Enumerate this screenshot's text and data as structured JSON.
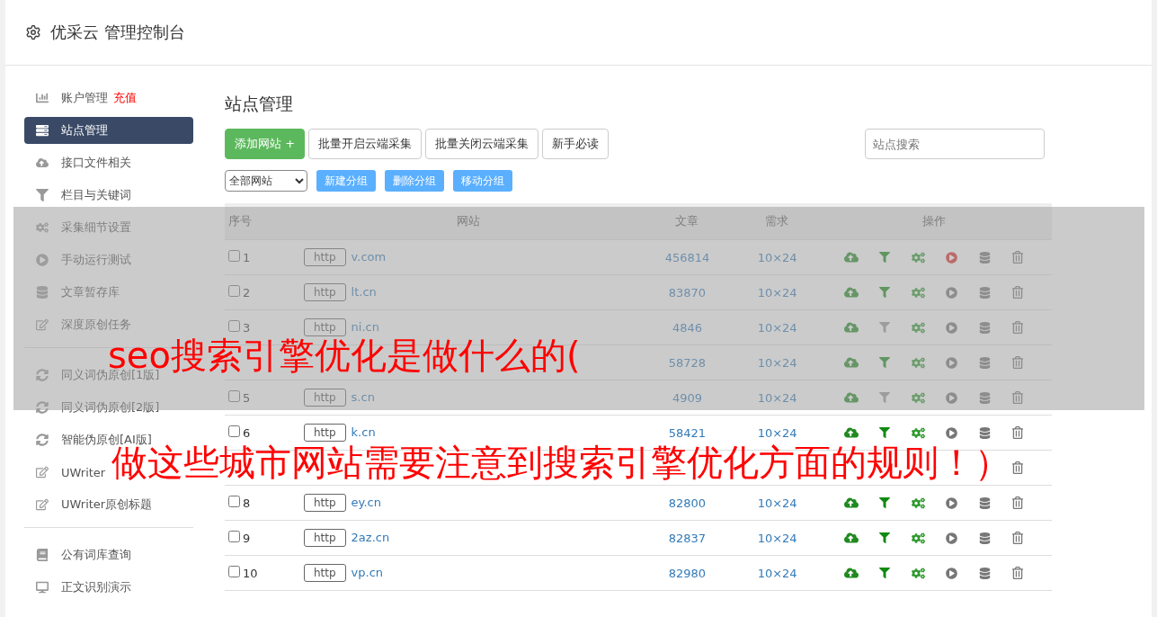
{
  "header": {
    "title": "优采云 管理控制台"
  },
  "sidebar": {
    "groups": [
      {
        "items": [
          {
            "kind": "chart",
            "label": "账户管理",
            "badge": "充值",
            "selected": false
          },
          {
            "kind": "server",
            "label": "站点管理",
            "selected": true
          },
          {
            "kind": "cloud",
            "label": "接口文件相关",
            "selected": false
          },
          {
            "kind": "filter",
            "label": "栏目与关键词",
            "selected": false
          },
          {
            "kind": "cogs",
            "label": "采集细节设置",
            "selected": false
          },
          {
            "kind": "play",
            "label": "手动运行测试",
            "selected": false
          },
          {
            "kind": "database",
            "label": "文章暂存库",
            "selected": false
          },
          {
            "kind": "edit",
            "label": "深度原创任务",
            "selected": false
          }
        ]
      },
      {
        "items": [
          {
            "kind": "sync",
            "label": "同义词伪原创[1版]",
            "selected": false
          },
          {
            "kind": "sync",
            "label": "同义词伪原创[2版]",
            "selected": false
          },
          {
            "kind": "sync",
            "label": "智能伪原创[AI版]",
            "selected": false
          },
          {
            "kind": "edit",
            "label": "UWriter",
            "selected": false
          },
          {
            "kind": "edit",
            "label": "UWriter原创标题",
            "selected": false
          }
        ]
      },
      {
        "items": [
          {
            "kind": "book",
            "label": "公有词库查询",
            "selected": false
          },
          {
            "kind": "desktop",
            "label": "正文识别演示",
            "selected": false
          }
        ]
      }
    ]
  },
  "main": {
    "title": "站点管理",
    "toolbar": [
      {
        "label": "添加网站 +",
        "kind": "primary"
      },
      {
        "label": "批量开启云端采集",
        "kind": "default"
      },
      {
        "label": "批量关闭云端采集",
        "kind": "default"
      },
      {
        "label": "新手必读",
        "kind": "default"
      }
    ],
    "search": {
      "placeholder": "站点搜索"
    },
    "group_select": {
      "value": "全部网站"
    },
    "group_buttons": [
      "新建分组",
      "删除分组",
      "移动分组"
    ],
    "table": {
      "columns": [
        "序号",
        "网站",
        "文章",
        "需求",
        "操作"
      ],
      "rows": [
        {
          "no": "1",
          "checked": false,
          "protocol": "http",
          "site": "v.com",
          "articles": "456814",
          "demand": "10×24",
          "actions": [
            {
              "kind": "upload"
            },
            {
              "kind": "filter",
              "on": true
            },
            {
              "kind": "gears"
            },
            {
              "kind": "play",
              "on": true
            },
            {
              "kind": "database"
            },
            {
              "kind": "trash"
            }
          ]
        },
        {
          "no": "2",
          "checked": false,
          "protocol": "http",
          "site": "lt.cn",
          "articles": "83870",
          "demand": "10×24",
          "actions": [
            {
              "kind": "upload"
            },
            {
              "kind": "filter",
              "on": true
            },
            {
              "kind": "gears"
            },
            {
              "kind": "play",
              "on": false
            },
            {
              "kind": "database"
            },
            {
              "kind": "trash"
            }
          ]
        },
        {
          "no": "3",
          "checked": false,
          "protocol": "http",
          "site": "ni.cn",
          "articles": "4846",
          "demand": "10×24",
          "actions": [
            {
              "kind": "upload"
            },
            {
              "kind": "filter",
              "on": false
            },
            {
              "kind": "gears"
            },
            {
              "kind": "play",
              "on": false
            },
            {
              "kind": "database"
            },
            {
              "kind": "trash"
            }
          ]
        },
        {
          "articles": "58728",
          "demand": "10×24",
          "actions": [
            {
              "kind": "upload"
            },
            {
              "kind": "filter",
              "on": true
            },
            {
              "kind": "gears"
            },
            {
              "kind": "play",
              "on": false
            },
            {
              "kind": "database"
            },
            {
              "kind": "trash"
            }
          ]
        },
        {
          "no": "5",
          "checked": false,
          "protocol": "http",
          "site": "s.cn",
          "articles": "4909",
          "demand": "10×24",
          "actions": [
            {
              "kind": "upload"
            },
            {
              "kind": "filter",
              "on": false
            },
            {
              "kind": "gears"
            },
            {
              "kind": "play",
              "on": false
            },
            {
              "kind": "database"
            },
            {
              "kind": "trash"
            }
          ]
        },
        {
          "no": "6",
          "checked": false,
          "protocol": "http",
          "site": "k.cn",
          "articles": "58421",
          "demand": "10×24",
          "actions": [
            {
              "kind": "upload"
            },
            {
              "kind": "filter",
              "on": true
            },
            {
              "kind": "gears"
            },
            {
              "kind": "play",
              "on": false
            },
            {
              "kind": "database"
            },
            {
              "kind": "trash"
            }
          ]
        },
        {
          "actions": [
            {
              "kind": "trash"
            }
          ]
        },
        {
          "no": "8",
          "checked": false,
          "protocol": "http",
          "site": "ey.cn",
          "articles": "82800",
          "demand": "10×24",
          "actions": [
            {
              "kind": "upload"
            },
            {
              "kind": "filter",
              "on": true
            },
            {
              "kind": "gears"
            },
            {
              "kind": "play",
              "on": false
            },
            {
              "kind": "database"
            },
            {
              "kind": "trash"
            }
          ]
        },
        {
          "no": "9",
          "checked": false,
          "protocol": "http",
          "site": "2az.cn",
          "articles": "82837",
          "demand": "10×24",
          "actions": [
            {
              "kind": "upload"
            },
            {
              "kind": "filter",
              "on": true
            },
            {
              "kind": "gears"
            },
            {
              "kind": "play",
              "on": false
            },
            {
              "kind": "database"
            },
            {
              "kind": "trash"
            }
          ]
        },
        {
          "no": "10",
          "checked": false,
          "protocol": "http",
          "site": "vp.cn",
          "articles": "82980",
          "demand": "10×24",
          "actions": [
            {
              "kind": "upload"
            },
            {
              "kind": "filter",
              "on": true
            },
            {
              "kind": "gears"
            },
            {
              "kind": "play",
              "on": false
            },
            {
              "kind": "database"
            },
            {
              "kind": "trash"
            }
          ]
        }
      ]
    }
  },
  "headline": {
    "lines": [
      "seo搜索引擎优化是做什么的(",
      "做这些城市网站需要注意到搜索引擎优化方面的规则！）"
    ]
  }
}
